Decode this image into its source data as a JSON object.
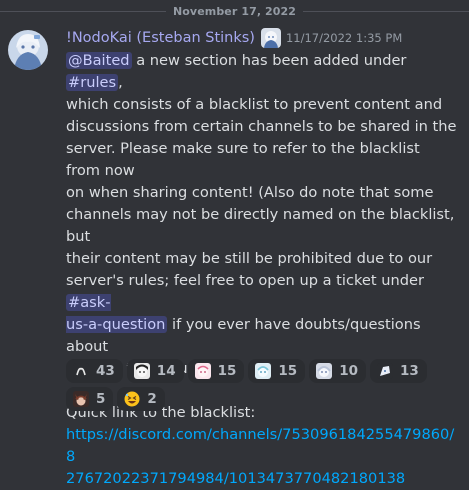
{
  "divider": {
    "date": "November 17, 2022"
  },
  "message": {
    "username": "!NodoKai (Esteban Stinks)",
    "timestamp": "11/17/2022 1:35 PM",
    "mention": "@Baited",
    "text_1": " a new section has been added under ",
    "channel_1": "#rules",
    "text_2": ",\nwhich consists of a blacklist to prevent content and\ndiscussions from certain channels to be shared in the\nserver. Please make sure to refer to the blacklist from now\non when sharing content! (Also do note that some\nchannels may not be directly named on the blacklist, but\ntheir content may be still be prohibited due to our\nserver's rules; feel free to open up a ticket under ",
    "channel_2a": "#ask-",
    "channel_2b": "us-a-question",
    "text_3": " if you ever have doubts/questions about\ncontent that you wish to share!)\n\nQuick link to the blacklist:\n",
    "link": "https://discord.com/channels/753096184255479860/8\n27672022371794984/1013473770482180138"
  },
  "reactions": [
    {
      "emoji": "emoji-a",
      "count": "43"
    },
    {
      "emoji": "emoji-b",
      "count": "14"
    },
    {
      "emoji": "emoji-c",
      "count": "15"
    },
    {
      "emoji": "emoji-d",
      "count": "15"
    },
    {
      "emoji": "emoji-e",
      "count": "10"
    },
    {
      "emoji": "emoji-f",
      "count": "13"
    },
    {
      "emoji": "emoji-g",
      "count": "5"
    },
    {
      "emoji": "grinning-squinting-face",
      "count": "2"
    }
  ]
}
